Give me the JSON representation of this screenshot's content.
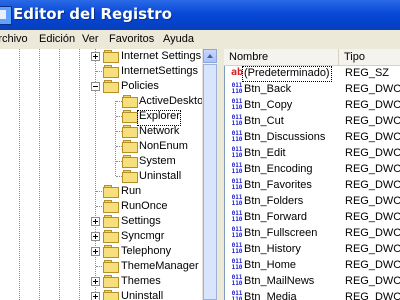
{
  "window": {
    "title": "Editor del Registro",
    "icon": "registry-editor-icon"
  },
  "menu": [
    "Archivo",
    "Edición",
    "Ver",
    "Favoritos",
    "Ayuda"
  ],
  "tree": {
    "items": [
      {
        "label": "Internet Settings",
        "expander": "plus"
      },
      {
        "label": "InternetSettings",
        "expander": "none"
      },
      {
        "label": "Policies",
        "expander": "minus"
      },
      {
        "label": "ActiveDesktop",
        "expander": "none"
      },
      {
        "label": "Explorer",
        "expander": "none"
      },
      {
        "label": "Network",
        "expander": "none"
      },
      {
        "label": "NonEnum",
        "expander": "none"
      },
      {
        "label": "System",
        "expander": "none"
      },
      {
        "label": "Uninstall",
        "expander": "none"
      },
      {
        "label": "Run",
        "expander": "none"
      },
      {
        "label": "RunOnce",
        "expander": "none"
      },
      {
        "label": "Settings",
        "expander": "plus"
      },
      {
        "label": "Syncmgr",
        "expander": "plus"
      },
      {
        "label": "Telephony",
        "expander": "plus"
      },
      {
        "label": "ThemeManager",
        "expander": "none"
      },
      {
        "label": "Themes",
        "expander": "plus"
      },
      {
        "label": "Uninstall",
        "expander": "plus"
      }
    ]
  },
  "list": {
    "columns": [
      "Nombre",
      "Tipo"
    ],
    "rows": [
      {
        "name": "(Predeterminado)",
        "type": "REG_SZ",
        "icon": "ab"
      },
      {
        "name": "Btn_Back",
        "type": "REG_DWORD",
        "icon": "dword"
      },
      {
        "name": "Btn_Copy",
        "type": "REG_DWORD",
        "icon": "dword"
      },
      {
        "name": "Btn_Cut",
        "type": "REG_DWORD",
        "icon": "dword"
      },
      {
        "name": "Btn_Discussions",
        "type": "REG_DWORD",
        "icon": "dword"
      },
      {
        "name": "Btn_Edit",
        "type": "REG_DWORD",
        "icon": "dword"
      },
      {
        "name": "Btn_Encoding",
        "type": "REG_DWORD",
        "icon": "dword"
      },
      {
        "name": "Btn_Favorites",
        "type": "REG_DWORD",
        "icon": "dword"
      },
      {
        "name": "Btn_Folders",
        "type": "REG_DWORD",
        "icon": "dword"
      },
      {
        "name": "Btn_Forward",
        "type": "REG_DWORD",
        "icon": "dword"
      },
      {
        "name": "Btn_Fullscreen",
        "type": "REG_DWORD",
        "icon": "dword"
      },
      {
        "name": "Btn_History",
        "type": "REG_DWORD",
        "icon": "dword"
      },
      {
        "name": "Btn_Home",
        "type": "REG_DWORD",
        "icon": "dword"
      },
      {
        "name": "Btn_MailNews",
        "type": "REG_DWORD",
        "icon": "dword"
      },
      {
        "name": "Btn_Media",
        "type": "REG_DWORD",
        "icon": "dword"
      }
    ]
  }
}
